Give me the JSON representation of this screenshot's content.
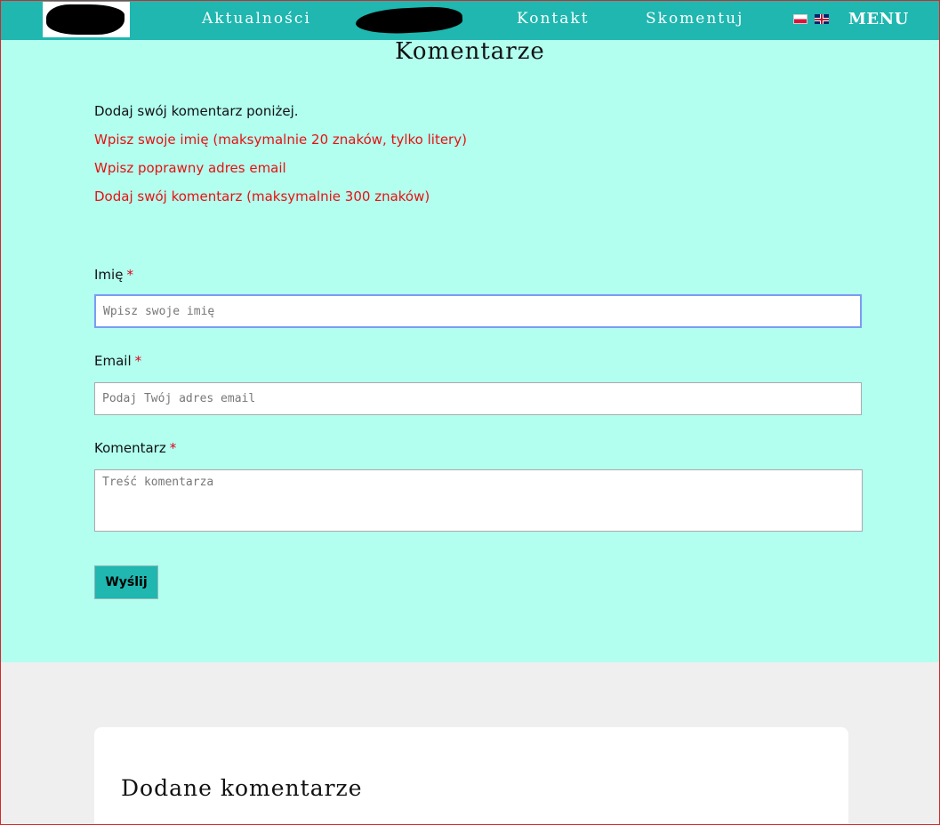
{
  "nav": {
    "links": [
      "Aktualności",
      "Kontakt",
      "Skomentuj"
    ],
    "menu_label": "MENU",
    "languages": [
      {
        "code": "pl",
        "icon": "flag-pl-icon"
      },
      {
        "code": "en",
        "icon": "flag-uk-icon"
      }
    ],
    "colors": {
      "bar": "#1fb7b0",
      "text": "#ffffff"
    }
  },
  "page": {
    "title": "Komentarze",
    "intro": "Dodaj swój komentarz poniżej.",
    "errors": [
      "Wpisz swoje imię (maksymalnie 20 znaków, tylko litery)",
      "Wpisz poprawny adres email",
      "Dodaj swój komentarz (maksymalnie 300 znaków)"
    ],
    "colors": {
      "background": "#b2fff0",
      "error": "#e8110f",
      "required": "#e0001a"
    }
  },
  "form": {
    "required_marker": "*",
    "name": {
      "label": "Imię",
      "placeholder": "Wpisz swoje imię",
      "value": ""
    },
    "email": {
      "label": "Email",
      "placeholder": "Podaj Twój adres email",
      "value": ""
    },
    "comment": {
      "label": "Komentarz",
      "placeholder": "Treść komentarza",
      "value": ""
    },
    "submit_label": "Wyślij"
  },
  "comments": {
    "title": "Dodane komentarze"
  }
}
